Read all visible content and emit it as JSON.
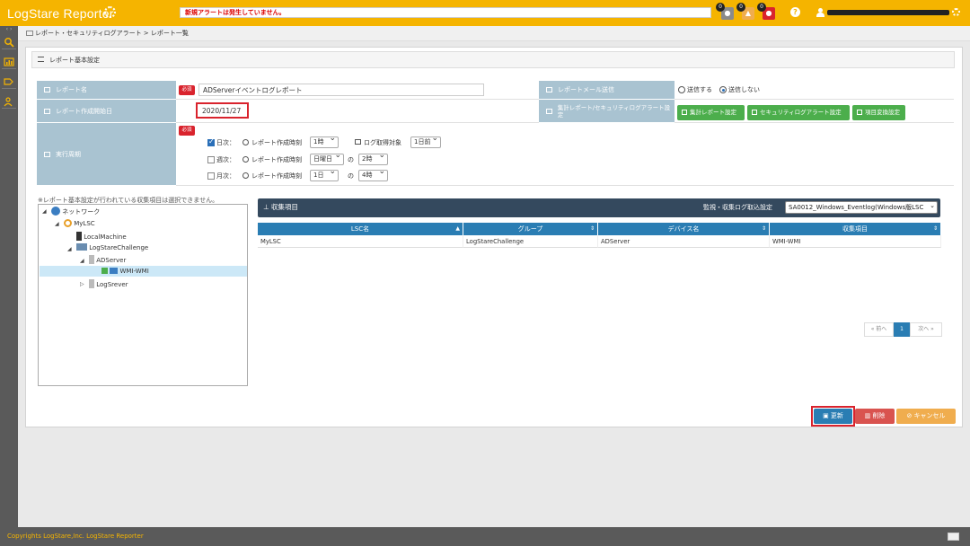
{
  "header": {
    "brand": "LogStare Reporter",
    "alert_message": "新規アラートは発生していません。",
    "badges": [
      {
        "count": "0"
      },
      {
        "count": "0"
      },
      {
        "count": "0"
      }
    ],
    "help": "?"
  },
  "breadcrumb": "レポート・セキュリティログアラート > レポート一覧",
  "panel": {
    "title": "レポート基本設定",
    "report_name_label": "レポート名",
    "required": "必須",
    "report_name_value": "ADServerイベントログレポート",
    "start_date_label": "レポート作成開始日",
    "start_date_value": "2020/11/27",
    "email_label": "レポートメール送信",
    "email_send": "送信する",
    "email_nosend": "送信しない",
    "aggregate_label": "集計レポート/セキュリティログアラート設定",
    "btn_aggregate": "集計レポート設定",
    "btn_security": "セキュリティログアラート設定",
    "btn_conversion": "項目変換設定",
    "schedule_label": "実行周期",
    "daily": {
      "label": "日次：",
      "time_label": "レポート作成時刻",
      "time_value": "1時",
      "log_label": "ログ取得対象",
      "log_value": "1日前"
    },
    "weekly": {
      "label": "週次：",
      "time_label": "レポート作成時刻",
      "day_value": "日曜日",
      "no": "の",
      "time_value": "2時"
    },
    "monthly": {
      "label": "月次：",
      "time_label": "レポート作成時刻",
      "day_value": "1日",
      "no": "の",
      "time_value": "4時"
    }
  },
  "tree": {
    "note": "※レポート基本設定が行われている収集項目は選択できません。",
    "nodes": [
      "ネットワーク",
      "MyLSC",
      "LocalMachine",
      "LogStareChallenge",
      "ADServer",
      "WMI-WMI",
      "LogSrever"
    ]
  },
  "collected": {
    "title": "収集項目",
    "monitor_label": "監視・収集ログ取込設定",
    "monitor_value": "SA0012_Windows_Eventlog(Windows版LSC",
    "columns": [
      "LSC名",
      "グループ",
      "デバイス名",
      "収集項目"
    ],
    "rows": [
      [
        "MyLSC",
        "LogStareChallenge",
        "ADServer",
        "WMI-WMI"
      ]
    ],
    "pager": {
      "prev": "« 前へ",
      "page": "1",
      "next": "次へ »"
    }
  },
  "buttons": {
    "update": "更新",
    "delete": "削除",
    "cancel": "キャンセル"
  },
  "footer": "Copyrights LogStare,Inc.  LogStare Reporter",
  "colors": {
    "brand": "#f5b400",
    "label_bg": "#a9c3d1",
    "green": "#4cae4c",
    "blue": "#2a7db3",
    "red": "#d9232d",
    "orange": "#f0ad4e"
  }
}
